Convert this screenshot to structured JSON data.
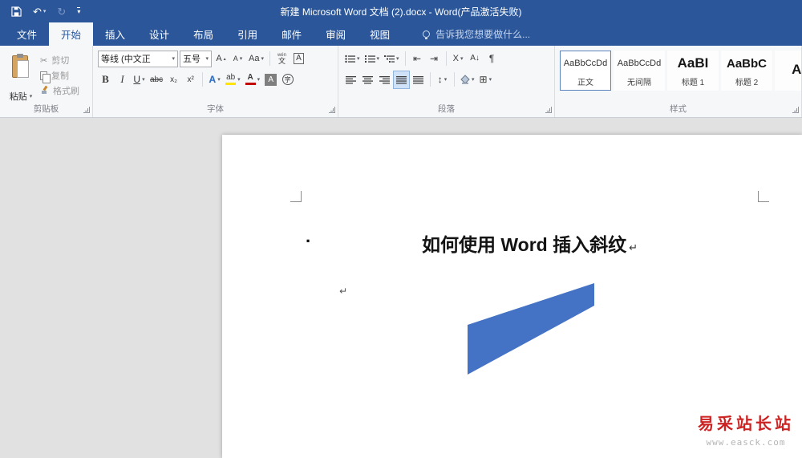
{
  "colors": {
    "titlebar_blue": "#2b579a",
    "shape_fill": "#4472c4",
    "watermark_red": "#cc2222",
    "highlight_yellow": "#ffe400",
    "font_color_red": "#c00000"
  },
  "icons": {
    "undo": "↶",
    "redo": "↻",
    "caret_down": "▾",
    "caret_up": "▴",
    "scissors": "✂",
    "indent_decrease": "⇤",
    "indent_increase": "⇥",
    "asian_layout": "X",
    "sort": "A↓",
    "pilcrow": "¶",
    "line_spacing": "↕",
    "borders": "⊞"
  },
  "titlebar": {
    "title": "新建 Microsoft Word 文档 (2).docx - Word(产品激活失败)"
  },
  "tabs": [
    {
      "label": "文件"
    },
    {
      "label": "开始",
      "active": true
    },
    {
      "label": "插入"
    },
    {
      "label": "设计"
    },
    {
      "label": "布局"
    },
    {
      "label": "引用"
    },
    {
      "label": "邮件"
    },
    {
      "label": "审阅"
    },
    {
      "label": "视图"
    }
  ],
  "tellme": {
    "text": "告诉我您想要做什么..."
  },
  "ribbon": {
    "clipboard": {
      "label": "剪贴板",
      "paste_label": "粘贴",
      "cut_label": "剪切",
      "copy_label": "复制",
      "format_painter_label": "格式刷"
    },
    "font": {
      "label": "字体",
      "name_value": "等线 (中文正",
      "size_value": "五号",
      "grow_letter": "A",
      "shrink_letter": "A",
      "case_label": "Aa",
      "ruby_top": "wén",
      "ruby_bottom": "文",
      "char_border_letter": "A",
      "bold": "B",
      "italic": "I",
      "underline": "U",
      "strike": "abc",
      "subscript": "x₂",
      "superscript": "x²",
      "effects_letter": "A",
      "highlight_label": "ab",
      "font_color_letter": "A",
      "char_shading_letter": "A",
      "enclose_char": "字"
    },
    "paragraph": {
      "label": "段落"
    },
    "styles": {
      "label": "样式",
      "items": [
        {
          "preview": "AaBbCcDd",
          "name": "正文"
        },
        {
          "preview": "AaBbCcDd",
          "name": "无间隔"
        },
        {
          "preview": "AaBI",
          "name": "标题 1"
        },
        {
          "preview": "AaBbC",
          "name": "标题 2"
        },
        {
          "preview": "Aa",
          "name": ""
        }
      ]
    }
  },
  "document": {
    "bullet": "·",
    "heading": "如何使用 Word 插入斜纹",
    "paragraph_mark": "↵",
    "empty_paragraph_mark": "↵",
    "shape": {
      "color": "#4472c4"
    }
  },
  "watermark": {
    "name": "易采站长站",
    "url": "www.easck.com"
  }
}
